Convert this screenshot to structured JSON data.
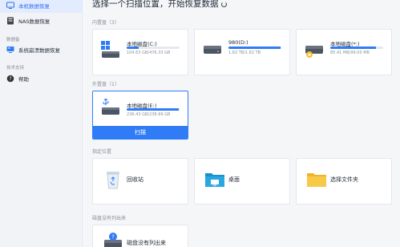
{
  "sidebar": {
    "items_top": [
      {
        "label": "本机数据恢复",
        "active": true
      },
      {
        "label": "NAS数据恢复",
        "active": false
      }
    ],
    "section_system": "数据备",
    "system_item": "系统崩溃数据恢复",
    "section_support": "技术支持",
    "help_item": "帮助"
  },
  "main": {
    "title": "选择一个扫描位置，开始恢复数据",
    "internal_label": "内置盘（3）",
    "external_label": "外置盘（1）",
    "specified_label": "指定位置",
    "missing_label": "磁盘没有列出来",
    "internal_drives": [
      {
        "name": "本地磁盘(C:)",
        "size": "104.63 GB/476.33 GB",
        "usage": 0.22,
        "icon": "windows-drive-icon"
      },
      {
        "name": "980(D:)",
        "size": "1.82 TB/1.82 TB",
        "usage": 0.99,
        "icon": "hard-drive-icon"
      },
      {
        "name": "本地磁盘(*:)",
        "size": "85.41 MB/99.00 MB",
        "usage": 0.86,
        "icon": "locked-drive-icon"
      }
    ],
    "external_drive": {
      "name": "本地磁盘(E:)",
      "size": "236.43 GB/238.69 GB",
      "usage": 0.99,
      "icon": "usb-drive-icon",
      "button": "扫描"
    },
    "locations": [
      {
        "label": "回收站",
        "icon": "recycle-bin-icon"
      },
      {
        "label": "桌面",
        "icon": "desktop-folder-icon"
      },
      {
        "label": "选择文件夹",
        "icon": "folder-icon"
      }
    ],
    "missing_card": {
      "label": "磁盘没有列出来",
      "icon": "disk-question-icon"
    }
  },
  "colors": {
    "accent": "#2f7cf6",
    "sidebar_bg": "#f1f3f7",
    "main_bg": "#f5f6f8",
    "active_bg": "#e3ecff"
  }
}
